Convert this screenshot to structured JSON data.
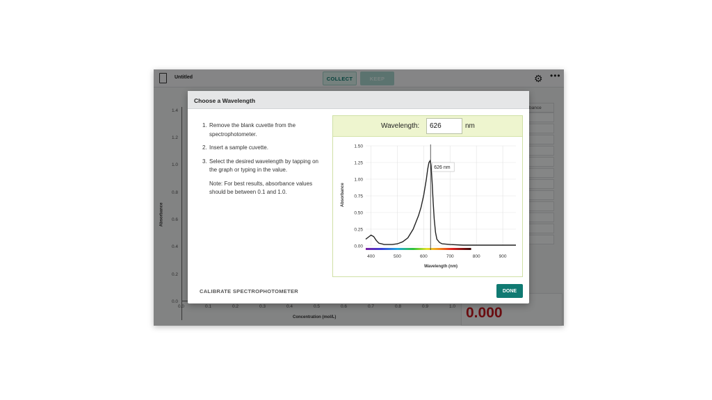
{
  "toolbar": {
    "document_title": "Untitled",
    "collect_label": "COLLECT",
    "keep_label": "KEEP",
    "icons": [
      "document-icon",
      "gear-icon",
      "more-icon"
    ]
  },
  "background_graph": {
    "y_ticks": [
      "1.4",
      "1.2",
      "1.0",
      "0.8",
      "0.6",
      "0.4",
      "0.2",
      "0.0"
    ],
    "x_ticks": [
      "0.0",
      "0.1",
      "0.2",
      "0.3",
      "0.4",
      "0.5",
      "0.6",
      "0.7",
      "0.8",
      "0.9",
      "1.0"
    ],
    "ylabel": "Absorbance",
    "xlabel": "Concentration (mol/L)"
  },
  "data_table": {
    "column_header": "Absorbance"
  },
  "meter": {
    "value": "0.000",
    "color": "#c5181f"
  },
  "dialog": {
    "title": "Choose a Wavelength",
    "steps": [
      {
        "num": "1.",
        "text": "Remove the blank cuvette from the spectrophotometer."
      },
      {
        "num": "2.",
        "text": "Insert a sample cuvette."
      },
      {
        "num": "3.",
        "text": "Select the desired wavelength by tapping on the graph or typing in the value."
      }
    ],
    "note": "Note: For best results, absorbance values should be between 0.1 and 1.0.",
    "wavelength_label": "Wavelength:",
    "wavelength_value": "626",
    "wavelength_unit": "nm",
    "calibrate_label": "CALIBRATE SPECTROPHOTOMETER",
    "done_label": "DONE",
    "accent_color": "#107a72"
  },
  "chart_data": {
    "type": "line",
    "xlabel": "Wavelength (nm)",
    "ylabel": "Absorbance",
    "xlim": [
      380,
      950
    ],
    "ylim": [
      0,
      1.5
    ],
    "x_ticks": [
      400,
      500,
      600,
      700,
      800,
      900
    ],
    "y_ticks": [
      0.0,
      0.25,
      0.5,
      0.75,
      1.0,
      1.25,
      1.5
    ],
    "grid": true,
    "selected_wavelength": 626,
    "selected_label": "626 nm",
    "spectrum_bar_range": [
      380,
      780
    ],
    "series": [
      {
        "x": [
          380,
          390,
          400,
          410,
          420,
          430,
          440,
          450,
          460,
          480,
          500,
          520,
          540,
          560,
          580,
          590,
          600,
          610,
          615,
          620,
          625,
          628,
          632,
          636,
          640,
          645,
          650,
          660,
          670,
          700,
          750,
          800,
          850,
          900,
          950
        ],
        "y": [
          0.1,
          0.13,
          0.16,
          0.14,
          0.08,
          0.04,
          0.03,
          0.02,
          0.02,
          0.02,
          0.03,
          0.06,
          0.12,
          0.25,
          0.45,
          0.58,
          0.76,
          1.0,
          1.15,
          1.25,
          1.28,
          1.2,
          0.95,
          0.65,
          0.4,
          0.2,
          0.1,
          0.05,
          0.03,
          0.02,
          0.01,
          0.01,
          0.01,
          0.01,
          0.01
        ]
      }
    ]
  }
}
